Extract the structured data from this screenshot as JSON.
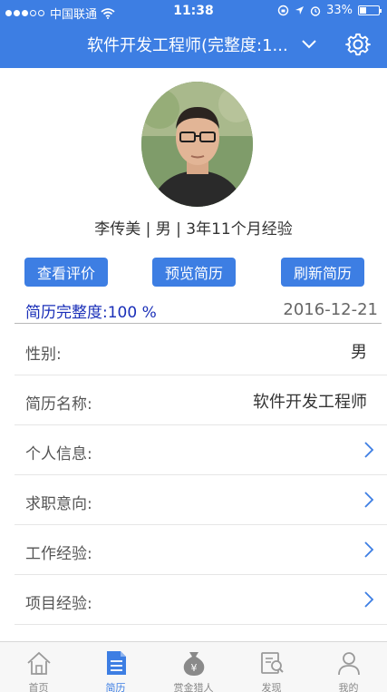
{
  "status_bar": {
    "carrier": "中国联通",
    "time": "11:38",
    "battery": "33%"
  },
  "nav": {
    "title": "软件开发工程师(完整度:1..."
  },
  "profile": {
    "summary": "李传美 | 男 | 3年11个月经验"
  },
  "actions": {
    "view_reviews": "查看评价",
    "preview_resume": "预览简历",
    "refresh_resume": "刷新简历"
  },
  "resume": {
    "completeness": "简历完整度:100 %",
    "date": "2016-12-21"
  },
  "fields": [
    {
      "label": "性别:",
      "value": "男"
    },
    {
      "label": "简历名称:",
      "value": "软件开发工程师"
    },
    {
      "label": "个人信息:"
    },
    {
      "label": "求职意向:"
    },
    {
      "label": "工作经验:"
    },
    {
      "label": "项目经验:"
    }
  ],
  "tabs": [
    {
      "label": "首页",
      "icon": "home-icon"
    },
    {
      "label": "简历",
      "icon": "resume-icon"
    },
    {
      "label": "赏金猎人",
      "icon": "money-bag-icon"
    },
    {
      "label": "发现",
      "icon": "discover-icon"
    },
    {
      "label": "我的",
      "icon": "profile-icon"
    }
  ],
  "colors": {
    "accent": "#3d7ee3",
    "completeness_text": "#1a2fb8",
    "tab_inactive": "#888888"
  }
}
